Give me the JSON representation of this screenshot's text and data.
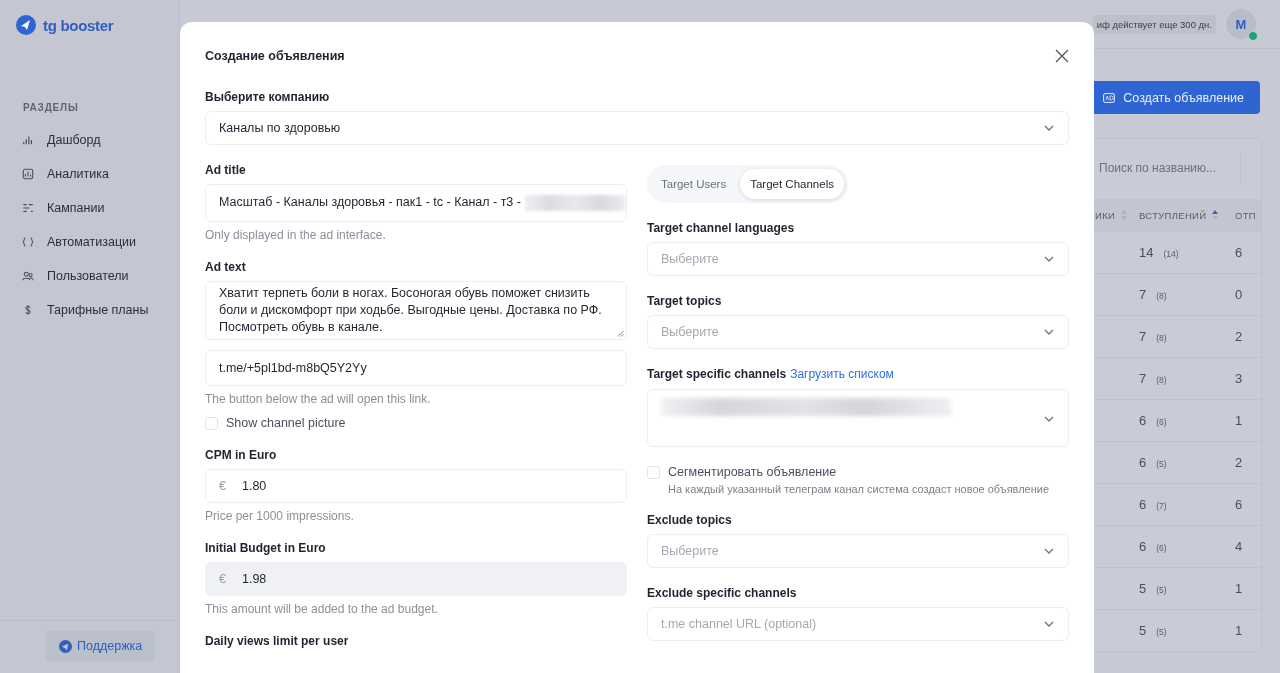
{
  "sidebar": {
    "logo": "tg booster",
    "section_title": "РАЗДЕЛЫ",
    "items": [
      {
        "label": "Дашборд"
      },
      {
        "label": "Аналитика"
      },
      {
        "label": "Кампании"
      },
      {
        "label": "Автоматизации"
      },
      {
        "label": "Пользователи"
      },
      {
        "label": "Тарифные планы"
      }
    ],
    "support_button": "Поддержка"
  },
  "header": {
    "tariff_badge": "иф действует еще 300 дн.",
    "avatar": {
      "initial": "M",
      "online": true
    },
    "create_button": "Создать объявление"
  },
  "table": {
    "search": {
      "placeholder": "Поиск по названию..."
    },
    "columns": [
      {
        "label": "ИКИ",
        "sorted": false
      },
      {
        "label": "ВСТУПЛЕНИЙ",
        "sorted": true
      },
      {
        "label": "ОТП"
      }
    ],
    "rows": [
      {
        "joins": "14",
        "joins_total": "(14)",
        "column_3": "6"
      },
      {
        "joins": "7",
        "joins_total": "(8)",
        "column_3": "0"
      },
      {
        "joins": "7",
        "joins_total": "(8)",
        "column_3": "2"
      },
      {
        "joins": "7",
        "joins_total": "(8)",
        "column_3": "3"
      },
      {
        "joins": "6",
        "joins_total": "(6)",
        "column_3": "1"
      },
      {
        "joins": "6",
        "joins_total": "(5)",
        "column_3": "2"
      },
      {
        "joins": "6",
        "joins_total": "(7)",
        "column_3": "6"
      },
      {
        "joins": "6",
        "joins_total": "(6)",
        "column_3": "4"
      },
      {
        "joins": "5",
        "joins_total": "(5)",
        "column_3": "1"
      },
      {
        "joins": "5",
        "joins_total": "(5)",
        "column_3": "1"
      }
    ]
  },
  "modal": {
    "title": "Создание объявления",
    "company": {
      "label": "Выберите компанию",
      "value": "Каналы по здоровью"
    },
    "left": [
      {
        "kind": "input",
        "label": "Ad title",
        "value": "Масштаб - Каналы здоровья - пак1 -  tc - Канал - т3 -",
        "redacted": true,
        "help": "Only displayed in the ad interface."
      },
      {
        "kind": "textarea",
        "label": "Ad text",
        "value": "Хватит терпеть боли в ногах. Босоногая обувь поможет снизить боли и дискомфорт при ходьбе. Выгодные цены. Доставка по РФ. Посмотреть обувь в канале."
      },
      {
        "kind": "input",
        "value": "t.me/+5pl1bd-m8bQ5Y2Yy",
        "help": "The button below the ad will open this link."
      },
      {
        "kind": "checkbox",
        "label": "Show channel picture",
        "checked": false
      },
      {
        "kind": "money",
        "label": "CPM in Euro",
        "currency": "€",
        "value": "1.80",
        "disabled": false,
        "help": "Price per 1000 impressions."
      },
      {
        "kind": "money",
        "label": "Initial Budget in Euro",
        "currency": "€",
        "value": "1.98",
        "disabled": true,
        "help": "This amount will be added to the ad budget."
      },
      {
        "kind": "heading",
        "label": "Daily views limit per user"
      }
    ],
    "tabs": [
      {
        "label": "Target Users",
        "selected": false
      },
      {
        "label": "Target Channels",
        "selected": true
      }
    ],
    "right": [
      {
        "kind": "select",
        "label": "Target channel languages",
        "placeholder": "Выберите"
      },
      {
        "kind": "select",
        "label": "Target topics",
        "placeholder": "Выберите"
      },
      {
        "kind": "chips",
        "label": "Target specific channels",
        "link": "Загрузить списком",
        "redacted": true
      },
      {
        "kind": "checkbox",
        "label": "Сегментировать объявление",
        "checked": false,
        "description": "На каждый указанный телеграм канал система создаст новое объявление"
      },
      {
        "kind": "select",
        "label": "Exclude topics",
        "placeholder": "Выберите"
      },
      {
        "kind": "select",
        "label": "Exclude specific channels",
        "placeholder": "t.me channel URL (optional)"
      }
    ]
  }
}
